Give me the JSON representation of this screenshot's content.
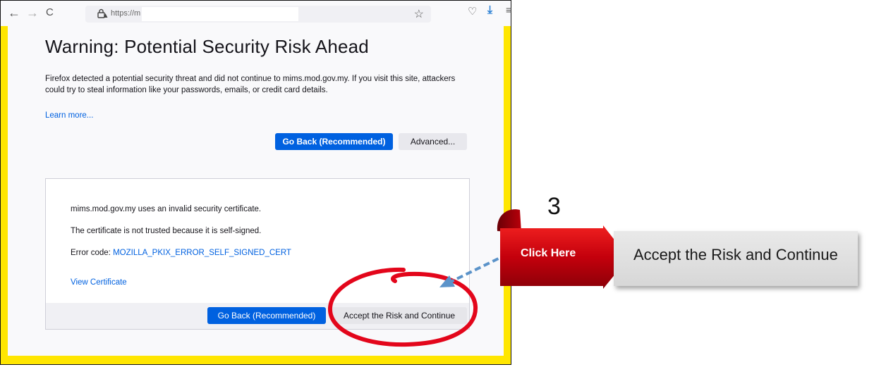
{
  "browser": {
    "url_text": "https://m",
    "back_glyph": "←",
    "forward_glyph": "→",
    "reload_glyph": "C",
    "star_glyph": "☆",
    "pocket_glyph": "♡",
    "download_glyph": "⤓",
    "menu_glyph": "≡"
  },
  "page": {
    "title": "Warning: Potential Security Risk Ahead",
    "description": "Firefox detected a potential security threat and did not continue to mims.mod.gov.my. If you visit this site, attackers could try to steal information like your passwords, emails, or credit card details.",
    "learn_more": "Learn more...",
    "go_back_label": "Go Back (Recommended)",
    "advanced_label": "Advanced..."
  },
  "advanced_panel": {
    "invalid_cert": "mims.mod.gov.my uses an invalid security certificate.",
    "not_trusted": "The certificate is not trusted because it is self-signed.",
    "error_code_label": "Error code: ",
    "error_code": "MOZILLA_PKIX_ERROR_SELF_SIGNED_CERT",
    "view_certificate": "View Certificate",
    "go_back_label": "Go Back (Recommended)",
    "accept_label": "Accept the Risk and Continue"
  },
  "annotation": {
    "step": "3",
    "click_here": "Click Here",
    "callout_text": "Accept the Risk and Continue"
  },
  "colors": {
    "accent": "#0061e0",
    "frame": "#ffe600",
    "annotation_red": "#d0021b"
  }
}
